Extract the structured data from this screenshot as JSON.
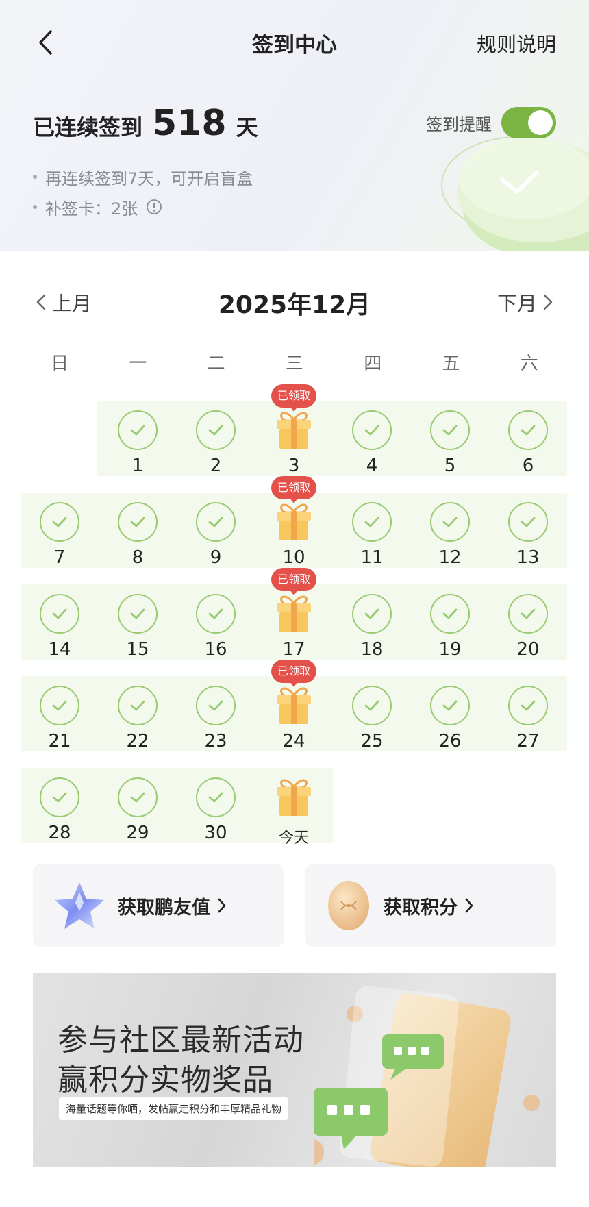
{
  "nav": {
    "title": "签到中心",
    "rules": "规则说明"
  },
  "streak": {
    "prefix": "已连续签到",
    "days": "518",
    "suffix": "天"
  },
  "tips": [
    "再连续签到7天，可开启盲盒",
    "补签卡：2张"
  ],
  "reminder": {
    "label": "签到提醒",
    "on": true
  },
  "calendar": {
    "prev": "上月",
    "month": "2025年12月",
    "next": "下月",
    "weekdays": [
      "日",
      "一",
      "二",
      "三",
      "四",
      "五",
      "六"
    ],
    "claimed_label": "已领取",
    "days": [
      {
        "label": "1",
        "kind": "checked"
      },
      {
        "label": "2",
        "kind": "checked"
      },
      {
        "label": "3",
        "kind": "gift",
        "claimed": true
      },
      {
        "label": "4",
        "kind": "checked"
      },
      {
        "label": "5",
        "kind": "checked"
      },
      {
        "label": "6",
        "kind": "checked"
      },
      {
        "label": "7",
        "kind": "checked"
      },
      {
        "label": "8",
        "kind": "checked"
      },
      {
        "label": "9",
        "kind": "checked"
      },
      {
        "label": "10",
        "kind": "gift",
        "claimed": true
      },
      {
        "label": "11",
        "kind": "checked"
      },
      {
        "label": "12",
        "kind": "checked"
      },
      {
        "label": "13",
        "kind": "checked"
      },
      {
        "label": "14",
        "kind": "checked"
      },
      {
        "label": "15",
        "kind": "checked"
      },
      {
        "label": "16",
        "kind": "checked"
      },
      {
        "label": "17",
        "kind": "gift",
        "claimed": true
      },
      {
        "label": "18",
        "kind": "checked"
      },
      {
        "label": "19",
        "kind": "checked"
      },
      {
        "label": "20",
        "kind": "checked"
      },
      {
        "label": "21",
        "kind": "checked"
      },
      {
        "label": "22",
        "kind": "checked"
      },
      {
        "label": "23",
        "kind": "checked"
      },
      {
        "label": "24",
        "kind": "gift",
        "claimed": true
      },
      {
        "label": "25",
        "kind": "checked"
      },
      {
        "label": "26",
        "kind": "checked"
      },
      {
        "label": "27",
        "kind": "checked"
      },
      {
        "label": "28",
        "kind": "checked"
      },
      {
        "label": "29",
        "kind": "checked"
      },
      {
        "label": "30",
        "kind": "checked"
      },
      {
        "label": "今天",
        "kind": "gift",
        "claimed": false
      }
    ]
  },
  "cards": [
    {
      "label": "获取鹏友值",
      "icon": "star-icon"
    },
    {
      "label": "获取积分",
      "icon": "coin-icon"
    }
  ],
  "banner": {
    "line1": "参与社区最新活动",
    "line2": "赢积分实物奖品",
    "sub": "海量话题等你晒，发帖赢走积分和丰厚精品礼物"
  },
  "colors": {
    "accent": "#7cb443",
    "check": "#9acb72",
    "row_bg": "#f4f9ee",
    "badge": "#e4514b"
  }
}
